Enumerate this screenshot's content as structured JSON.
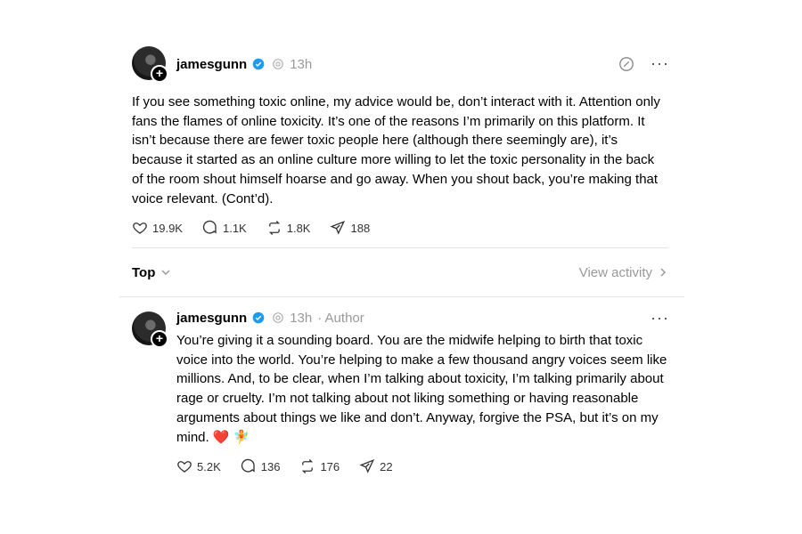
{
  "post": {
    "username": "jamesgunn",
    "time": "13h",
    "text": "If you see something toxic online, my advice would be, don’t interact with it. Attention only fans the flames of online toxicity. It’s one of the reasons I’m primarily on this platform. It isn’t because there are fewer toxic people here (although there seemingly are), it’s because it started as an online culture more willing to let the toxic personality in the back of the room shout himself hoarse and go away. When you shout back, you’re making that voice relevant. (Cont’d).",
    "likes": "19.9K",
    "replies": "1.1K",
    "reposts": "1.8K",
    "shares": "188"
  },
  "filter": {
    "sort_label": "Top",
    "view_activity": "View activity"
  },
  "reply": {
    "username": "jamesgunn",
    "time": "13h",
    "author_tag": "· Author",
    "text": "You’re giving it a sounding board. You are the midwife helping to birth that toxic voice into the world. You’re helping to make a few thousand angry voices seem like millions. And, to be clear, when I’m talking about toxicity, I’m talking primarily about rage or cruelty. I’m not talking about not liking something or having reasonable arguments about things we like and don’t. Anyway, forgive the PSA, but it’s on my mind. ❤️ 🧚",
    "likes": "5.2K",
    "replies": "136",
    "reposts": "176",
    "shares": "22"
  },
  "colors": {
    "verified": "#1d9bf0",
    "muted": "#999999",
    "divider": "#e5e5e5"
  },
  "icons": [
    "avatar",
    "verified-icon",
    "thread-icon",
    "edit-icon",
    "more-icon",
    "heart-icon",
    "comment-icon",
    "repost-icon",
    "share-icon",
    "chevron-down-icon",
    "chevron-right-icon"
  ]
}
